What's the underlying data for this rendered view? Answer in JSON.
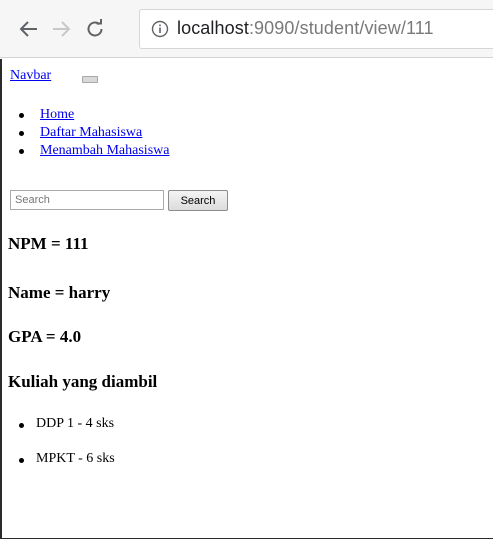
{
  "browser": {
    "url_host": "localhost",
    "url_rest": ":9090/student/view/111"
  },
  "navbar": {
    "brand": "Navbar",
    "items": [
      {
        "label": "Home"
      },
      {
        "label": "Daftar Mahasiswa"
      },
      {
        "label": "Menambah Mahasiswa"
      }
    ],
    "search_placeholder": "Search",
    "search_button": "Search"
  },
  "student": {
    "npm": "NPM = 111",
    "name": "Name = harry",
    "gpa": "GPA = 4.0",
    "courses_heading": "Kuliah yang diambil",
    "courses": [
      {
        "label": "DDP 1 - 4 sks"
      },
      {
        "label": "MPKT - 6 sks"
      }
    ]
  }
}
